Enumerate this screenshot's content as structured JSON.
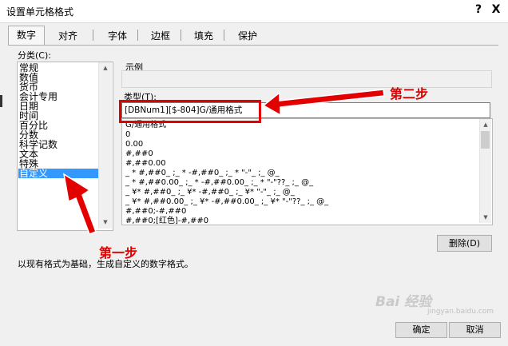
{
  "dialog": {
    "title": "设置单元格格式",
    "help": "?",
    "close": "X"
  },
  "tabs": [
    "数字",
    "对齐",
    "字体",
    "边框",
    "填充",
    "保护"
  ],
  "category": {
    "label": "分类(C):",
    "items": [
      "常规",
      "数值",
      "货币",
      "会计专用",
      "日期",
      "时间",
      "百分比",
      "分数",
      "科学记数",
      "文本",
      "特殊",
      "自定义"
    ],
    "selected_index": 11
  },
  "sample": {
    "label": "示例",
    "value": ""
  },
  "type": {
    "label": "类型(T):",
    "value": "[DBNum1][$-804]G/通用格式"
  },
  "formats": [
    "G/通用格式",
    "0",
    "0.00",
    "#,##0",
    "#,##0.00",
    "_ * #,##0_ ;_ * -#,##0_ ;_ * \"-\"_ ;_ @_",
    "_ * #,##0.00_ ;_ * -#,##0.00_ ;_ * \"-\"??_ ;_ @_",
    "_ ¥* #,##0_ ;_ ¥* -#,##0_ ;_ ¥* \"-\"_ ;_ @_",
    "_ ¥* #,##0.00_ ;_ ¥* -#,##0.00_ ;_ ¥* \"-\"??_ ;_ @_",
    "#,##0;-#,##0",
    "#,##0;[红色]-#,##0"
  ],
  "buttons": {
    "delete": "删除(D)",
    "ok": "确定",
    "cancel": "取消"
  },
  "description": "以现有格式为基础，生成自定义的数字格式。",
  "annotations": {
    "step1": "第一步",
    "step2": "第二步",
    "color": "#e30000"
  },
  "watermark": {
    "main": "Bai 经验",
    "sub": "jingyan.baidu.com"
  }
}
